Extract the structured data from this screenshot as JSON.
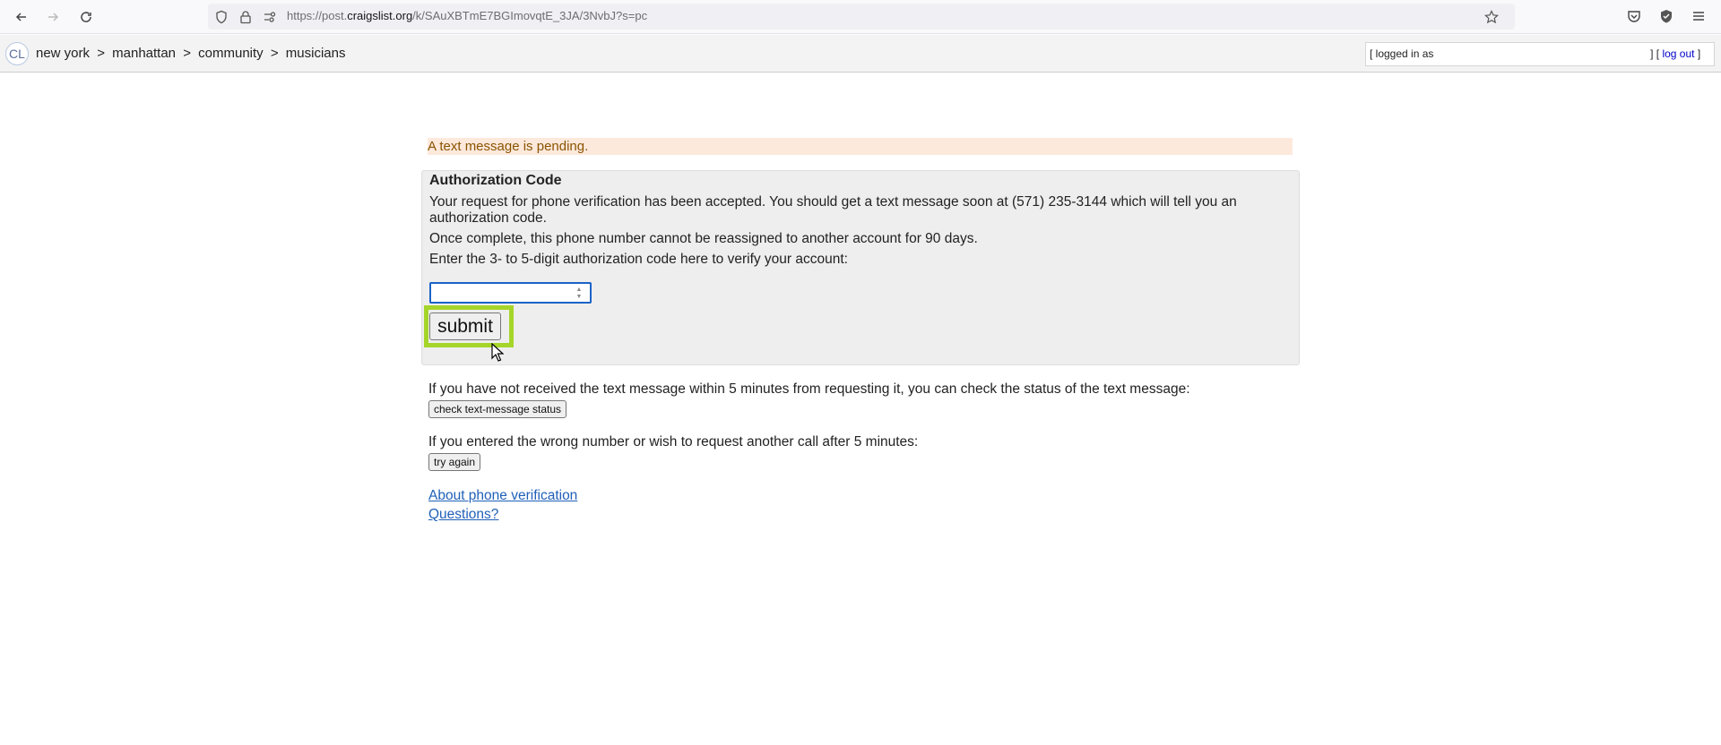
{
  "browser": {
    "url_prefix": "https://post.",
    "url_domain": "craigslist.org",
    "url_path": "/k/SAuXBTmE7BGImovqtE_3JA/3NvbJ?s=pc"
  },
  "header": {
    "logo": "CL",
    "breadcrumbs": [
      "new york",
      ">",
      "manhattan",
      ">",
      "community",
      ">",
      "musicians"
    ],
    "login_prefix": "[ logged in as",
    "login_mid": "] [",
    "logout": "log out",
    "login_suffix": "]"
  },
  "main": {
    "pending_notice": "A text message is pending.",
    "auth_title": "Authorization Code",
    "auth_line1": "Your request for phone verification has been accepted. You should get a text message soon at (571) 235-3144 which will tell you an",
    "auth_line1b": "authorization code.",
    "auth_line2": "Once complete, this phone number cannot be reassigned to another account for 90 days.",
    "auth_line3": "Enter the 3- to 5-digit authorization code here to verify your account:",
    "code_value": "",
    "submit_label": "submit",
    "status_text": "If you have not received the text message within 5 minutes from requesting it, you can check the status of the text message:",
    "status_button": "check text-message status",
    "retry_text": "If you entered the wrong number or wish to request another call after 5 minutes:",
    "retry_button": "try again",
    "link_about": "About phone verification",
    "link_questions": "Questions?"
  },
  "colors": {
    "highlight": "#a6d52a",
    "pending_bg": "#fde9dc",
    "pending_text": "#8a5300",
    "link": "#1f5fb8"
  }
}
